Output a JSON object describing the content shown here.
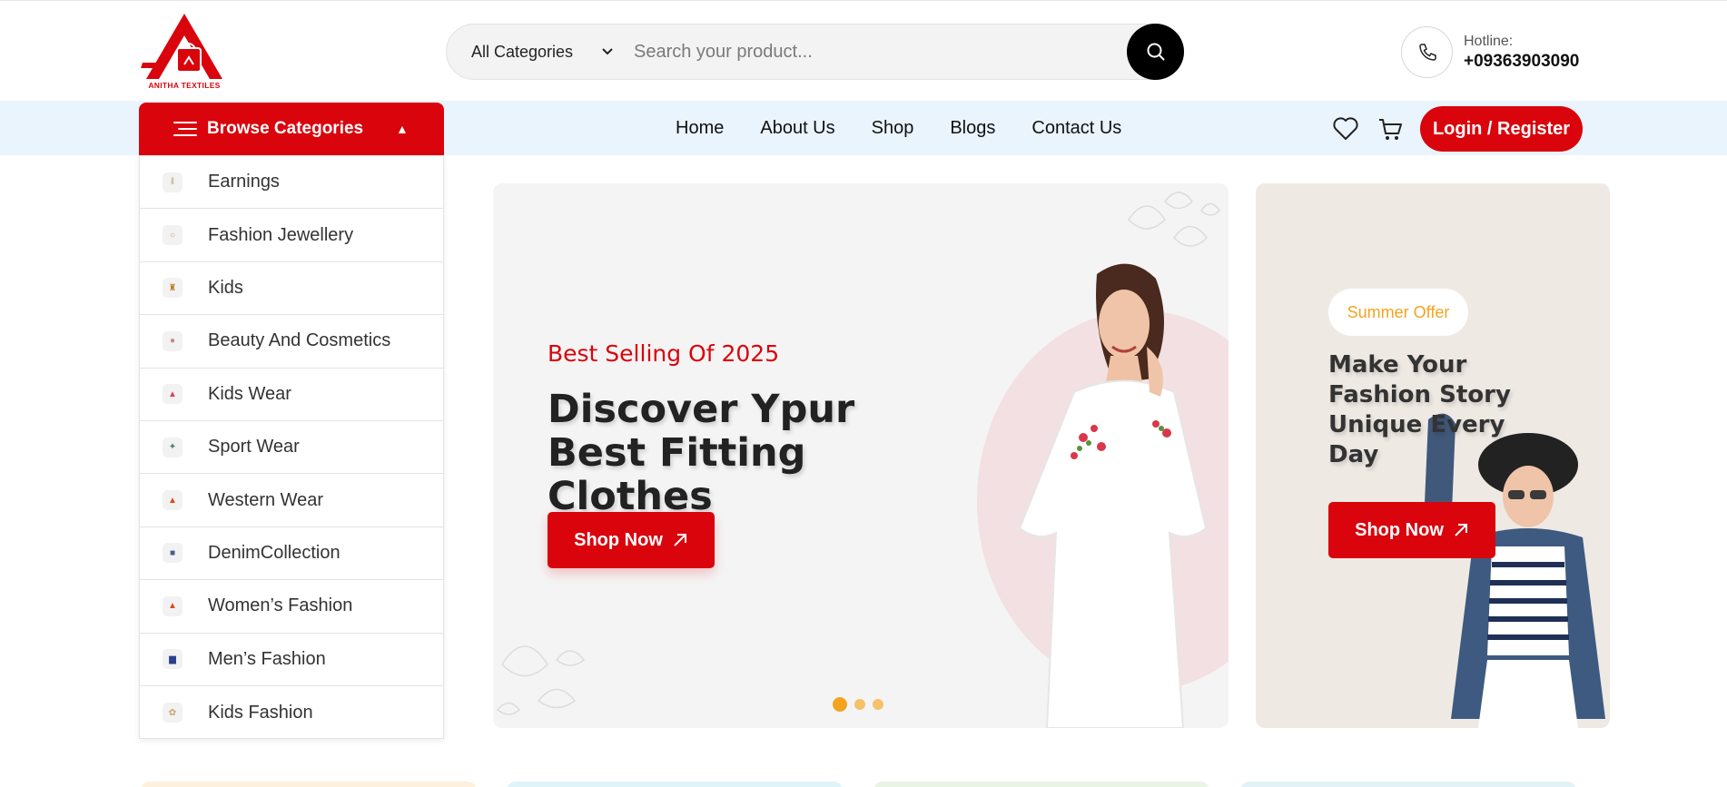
{
  "header": {
    "logo_text": "ANITHA TEXTILES",
    "search": {
      "category": "All Categories",
      "placeholder": "Search your product..."
    },
    "hotline": {
      "label": "Hotline:",
      "number": "+09363903090"
    }
  },
  "nav": {
    "browse_label": "Browse Categories",
    "links": [
      "Home",
      "About Us",
      "Shop",
      "Blogs",
      "Contact Us"
    ],
    "login_label": "Login / Register"
  },
  "categories": [
    {
      "label": "Earnings",
      "icon": "earrings-icon"
    },
    {
      "label": "Fashion Jewellery",
      "icon": "ring-icon"
    },
    {
      "label": "Kids",
      "icon": "kid-icon"
    },
    {
      "label": "Beauty And Cosmetics",
      "icon": "cosmetics-icon"
    },
    {
      "label": "Kids Wear",
      "icon": "dress-icon"
    },
    {
      "label": "Sport Wear",
      "icon": "sport-icon"
    },
    {
      "label": "Western Wear",
      "icon": "western-icon"
    },
    {
      "label": "DenimCollection",
      "icon": "denim-icon"
    },
    {
      "label": "Women’s Fashion",
      "icon": "women-icon"
    },
    {
      "label": "Men’s Fashion",
      "icon": "men-icon"
    },
    {
      "label": "Kids Fashion",
      "icon": "kids-fashion-icon"
    }
  ],
  "hero": {
    "subtitle": "Best Selling Of 2025",
    "title": "Discover Ypur Best Fitting Clothes",
    "button": "Shop Now"
  },
  "side_banner": {
    "tag": "Summer Offer",
    "title": "Make Your Fashion Story Unique Every Day",
    "button": "Shop Now"
  },
  "colors": {
    "brand_red": "#d9040c",
    "accent_orange": "#f3a31f",
    "nav_bg": "#eaf4fd"
  }
}
